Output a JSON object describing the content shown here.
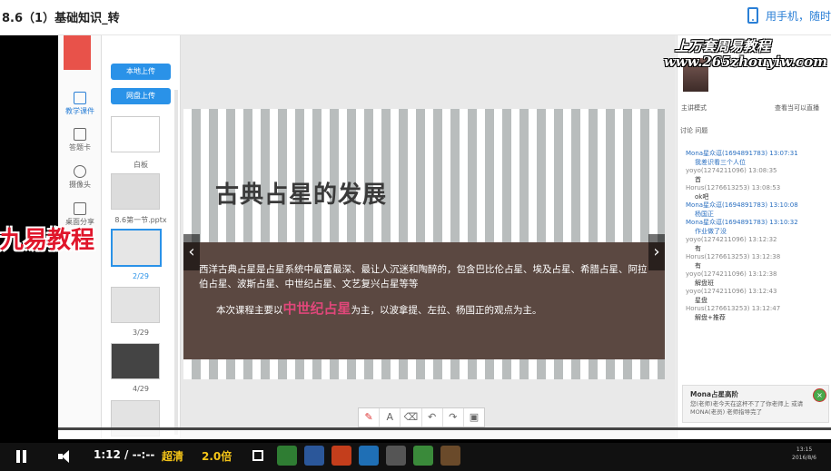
{
  "page": {
    "title": "8.6（1）基础知识_转",
    "mobile_label": "用手机，随时"
  },
  "left_nav": {
    "items": [
      {
        "label": "教学课件"
      },
      {
        "label": "答题卡"
      },
      {
        "label": "摄像头"
      },
      {
        "label": "桌面分享"
      }
    ]
  },
  "slide_panel": {
    "upload_local": "本地上传",
    "upload_network": "网盘上传",
    "thumbs": [
      {
        "label": "白板"
      },
      {
        "label": "8.6第一节.pptx"
      },
      {
        "label": "2/29"
      },
      {
        "label": "3/29"
      },
      {
        "label": "4/29"
      }
    ]
  },
  "slide": {
    "title": "古典占星的发展",
    "para1": "西洋古典占星是占星系统中最富最深、最让人沉迷和陶醉的，包含巴比伦占星、埃及占星、希腊占星、阿拉伯占星、波斯占星、中世纪占星、文艺复兴占星等等",
    "para2_prefix": "本次课程主要以",
    "para2_highlight": "中世纪占星",
    "para2_suffix": "为主，以波拿提、左拉、杨国正的观点为主。"
  },
  "chat": {
    "mode": "主讲模式",
    "action": "查看当可以直播",
    "tabs": "讨论  问题",
    "messages": [
      {
        "style": "blue",
        "text": "Mona星众逗(1694891783) 13:07:31"
      },
      {
        "style": "content",
        "text": "我差识看三个人位"
      },
      {
        "style": "normal",
        "text": "yoyo(1274211096) 13:08:35"
      },
      {
        "style": "dark",
        "text": "首"
      },
      {
        "style": "normal",
        "text": "Horus(1276613253) 13:08:53"
      },
      {
        "style": "dark",
        "text": "ok吧"
      },
      {
        "style": "blue",
        "text": "Mona星众逗(1694891783) 13:10:08"
      },
      {
        "style": "content",
        "text": "杨国正"
      },
      {
        "style": "blue",
        "text": "Mona星众逗(1694891783) 13:10:32"
      },
      {
        "style": "content",
        "text": "作业做了没"
      },
      {
        "style": "normal",
        "text": "yoyo(1274211096) 13:12:32"
      },
      {
        "style": "dark",
        "text": "有"
      },
      {
        "style": "normal",
        "text": "Horus(1276613253) 13:12:38"
      },
      {
        "style": "dark",
        "text": "有"
      },
      {
        "style": "normal",
        "text": "yoyo(1274211096) 13:12:38"
      },
      {
        "style": "dark",
        "text": "解盘班"
      },
      {
        "style": "normal",
        "text": "yoyo(1274211096) 13:12:43"
      },
      {
        "style": "dark",
        "text": "星盘"
      },
      {
        "style": "normal",
        "text": "Horus(1276613253) 13:12:47"
      },
      {
        "style": "dark",
        "text": "解盘+推荐"
      }
    ],
    "notice_title": "Mona占星高阶",
    "notice_body": "您(老师)老今天在这杯不了了你老师上 或请MONA(老员) 老师指导完了"
  },
  "watermark": {
    "line1": "上万套周易教程",
    "line2": "www.265zhouyiw.com"
  },
  "logo": {
    "text": "九易教程"
  },
  "player": {
    "time": "1:12 / --:--",
    "quality": "超清",
    "speed": "2.0倍",
    "progress_fraction": 0.0,
    "sys_time": "13:15",
    "sys_date": "2016/8/6"
  }
}
